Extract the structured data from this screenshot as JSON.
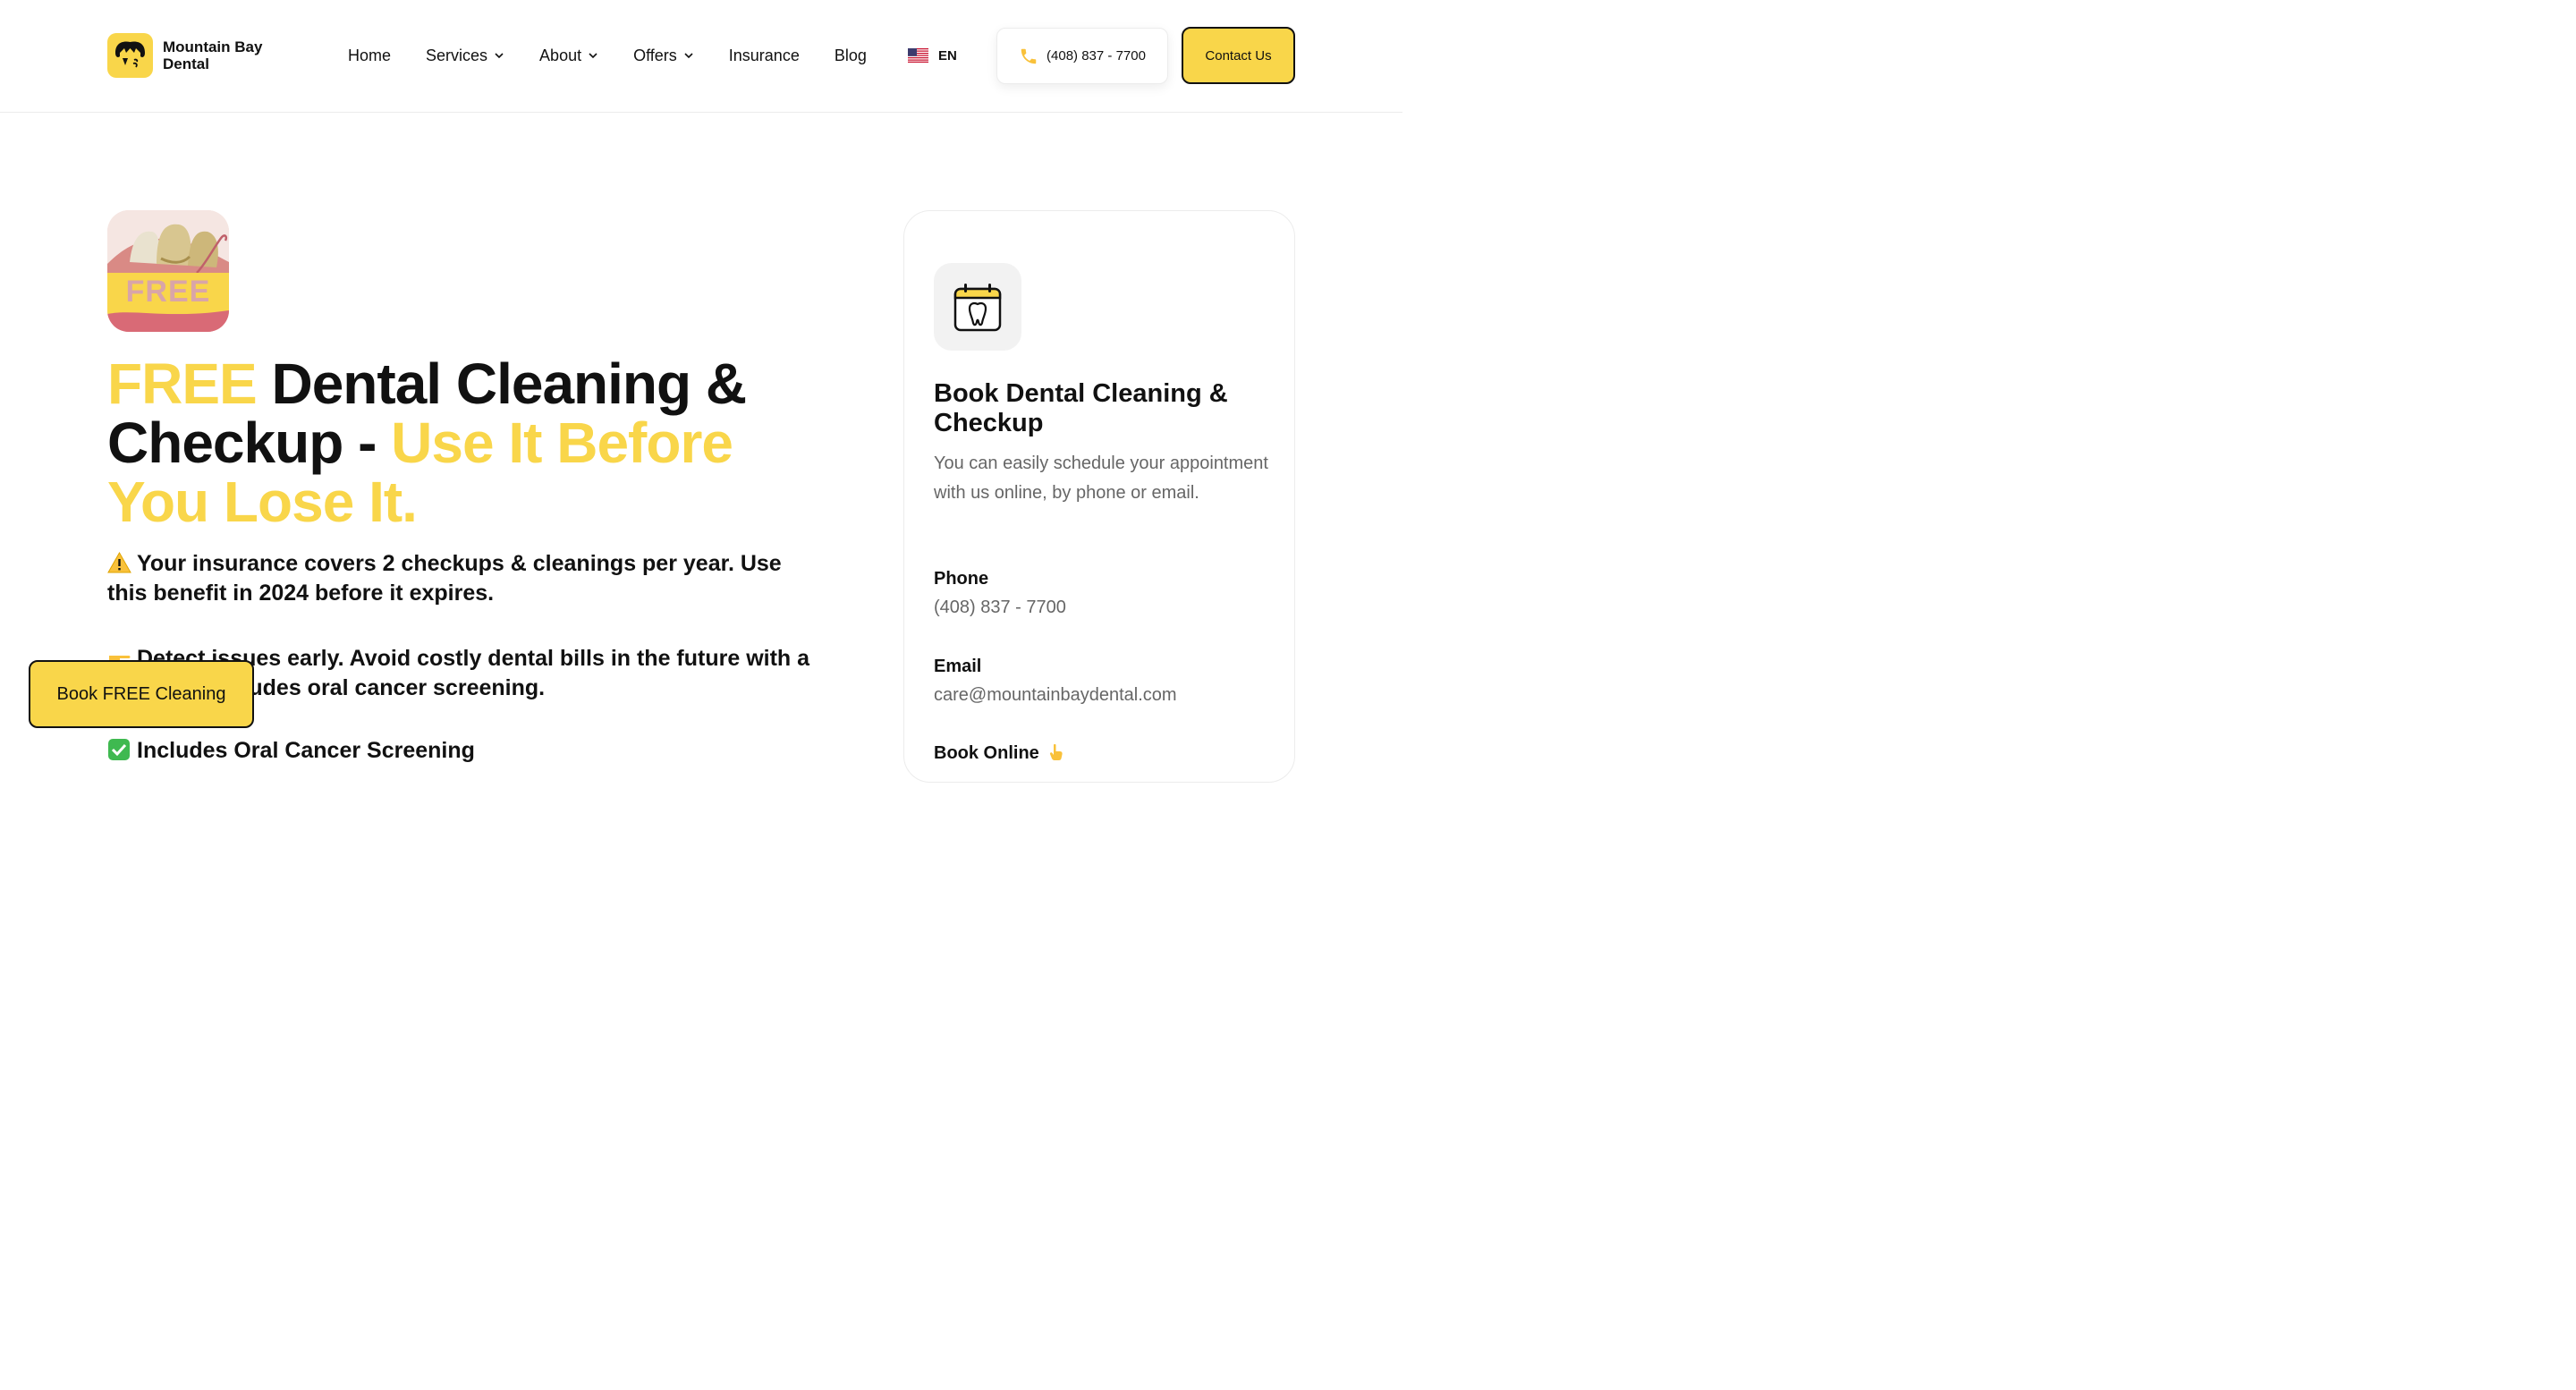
{
  "brand": {
    "name_line1": "Mountain Bay",
    "name_line2": "Dental",
    "accent_color": "#f9d64a"
  },
  "nav": {
    "items": [
      {
        "label": "Home",
        "has_dropdown": false
      },
      {
        "label": "Services",
        "has_dropdown": true
      },
      {
        "label": "About",
        "has_dropdown": true
      },
      {
        "label": "Offers",
        "has_dropdown": true
      },
      {
        "label": "Insurance",
        "has_dropdown": false
      },
      {
        "label": "Blog",
        "has_dropdown": false
      }
    ],
    "language": "EN",
    "phone": "(408) 837 - 7700",
    "contact_label": "Contact Us"
  },
  "hero": {
    "badge_text": "FREE",
    "title_part1": "FREE",
    "title_part2": " Dental Cleaning & Checkup - ",
    "title_part3": "Use It Before You Lose It.",
    "point1_icon": "warning-icon",
    "point1": "Your insurance covers 2 checkups & cleanings per year. Use this benefit in 2024 before it expires.",
    "point2_icon": "pointing-hand-icon",
    "point2": "Detect issues early. Avoid costly dental bills in the future with a checkup. Includes oral cancer screening.",
    "point3_icon": "check-mark-icon",
    "point3": "Includes Oral Cancer Screening"
  },
  "floating_cta": {
    "label": "Book FREE Cleaning"
  },
  "booking_card": {
    "icon": "calendar-tooth-icon",
    "title": "Book Dental Cleaning & Checkup",
    "description": "You can easily schedule your appointment with us online, by phone or email.",
    "phone_label": "Phone",
    "phone_value": "(408) 837 - 7700",
    "email_label": "Email",
    "email_value": "care@mountainbaydental.com",
    "online_label": "Book Online"
  }
}
